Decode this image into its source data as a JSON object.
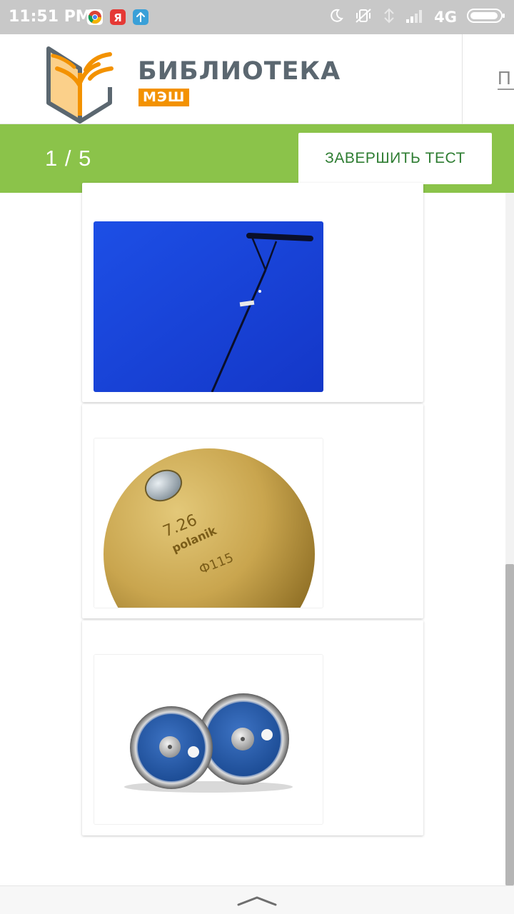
{
  "status_bar": {
    "time": "11:51 PM",
    "network": "4G",
    "apps": [
      "chrome-icon",
      "yandex-icon",
      "upload-icon"
    ],
    "indicators": [
      "moon-icon",
      "vibrate-off-icon",
      "signal-icon",
      "signal-bars-icon",
      "battery-icon"
    ]
  },
  "header": {
    "brand_title": "БИБЛИОТЕКА",
    "brand_badge": "МЭШ",
    "cut_text": "П"
  },
  "test_bar": {
    "counter": "1 / 5",
    "finish_button": "ЗАВЕРШИТЬ ТЕСТ"
  },
  "options": [
    {
      "image": "hammer-throw-photo"
    },
    {
      "image": "shot-put-ball-photo",
      "engraving": [
        "7.26",
        "polanik",
        "Ф115"
      ]
    },
    {
      "image": "discus-photo"
    }
  ],
  "colors": {
    "accent_green": "#8bc34a",
    "button_text": "#2e7d32",
    "brand_orange": "#f39200",
    "brand_gray": "#5b6770"
  }
}
